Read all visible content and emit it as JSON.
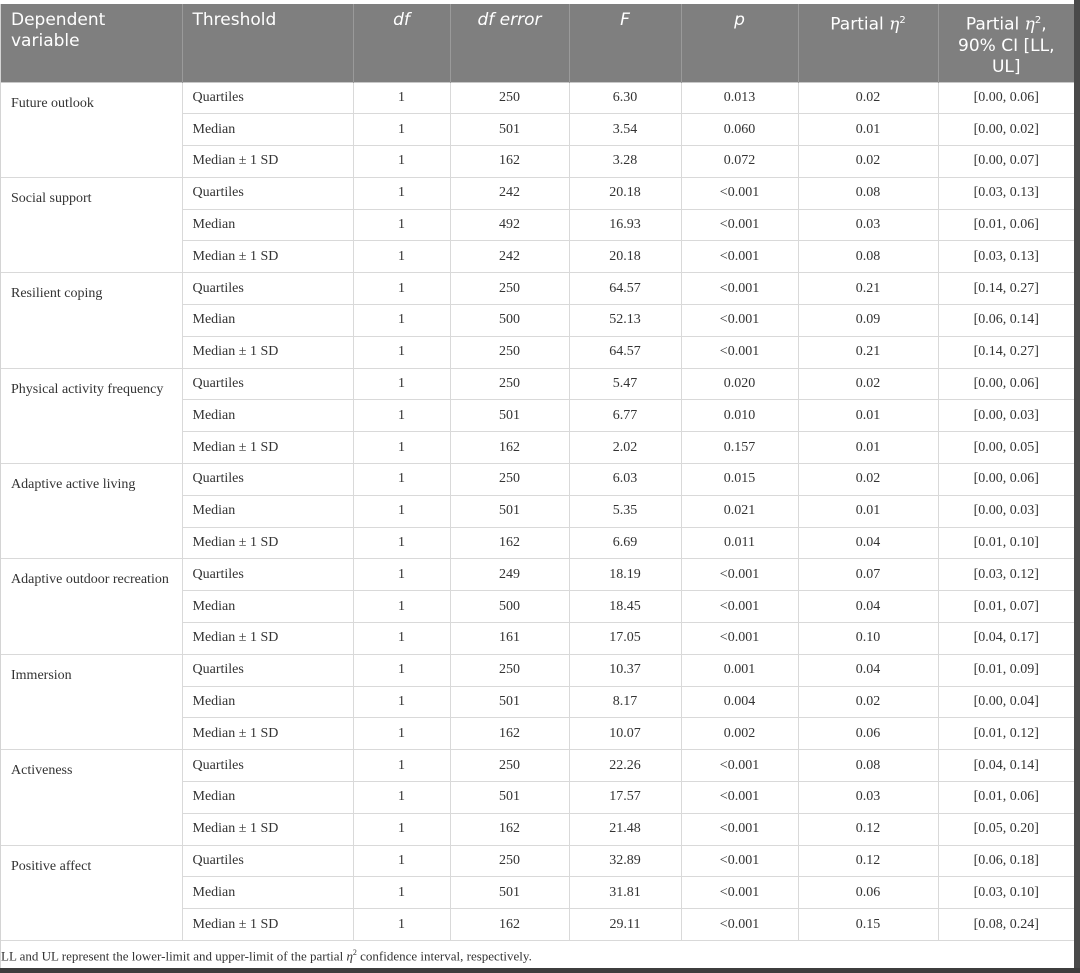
{
  "table": {
    "headers": [
      {
        "text": "Dependent variable",
        "style": "left"
      },
      {
        "text": "Threshold",
        "style": "left"
      },
      {
        "text": "df",
        "style": "center-italic"
      },
      {
        "text": "df error",
        "style": "center-italic"
      },
      {
        "text": "F",
        "style": "center-italic"
      },
      {
        "text": "p",
        "style": "center-italic"
      },
      {
        "pre": "Partial ",
        "eta": "η",
        "sup": "2",
        "post": ""
      },
      {
        "pre": "Partial ",
        "eta": "η",
        "sup": "2",
        "post": ", 90% CI [LL, UL]"
      }
    ],
    "groups": [
      {
        "variable": "Future outlook",
        "rows": [
          {
            "threshold": "Quartiles",
            "df": "1",
            "df_error": "250",
            "F": "6.30",
            "p": "0.013",
            "eta2": "0.02",
            "ci": "[0.00, 0.06]"
          },
          {
            "threshold": "Median",
            "df": "1",
            "df_error": "501",
            "F": "3.54",
            "p": "0.060",
            "eta2": "0.01",
            "ci": "[0.00, 0.02]"
          },
          {
            "threshold": "Median ± 1 SD",
            "df": "1",
            "df_error": "162",
            "F": "3.28",
            "p": "0.072",
            "eta2": "0.02",
            "ci": "[0.00, 0.07]"
          }
        ]
      },
      {
        "variable": "Social support",
        "rows": [
          {
            "threshold": "Quartiles",
            "df": "1",
            "df_error": "242",
            "F": "20.18",
            "p": "<0.001",
            "eta2": "0.08",
            "ci": "[0.03, 0.13]"
          },
          {
            "threshold": "Median",
            "df": "1",
            "df_error": "492",
            "F": "16.93",
            "p": "<0.001",
            "eta2": "0.03",
            "ci": "[0.01, 0.06]"
          },
          {
            "threshold": "Median ± 1 SD",
            "df": "1",
            "df_error": "242",
            "F": "20.18",
            "p": "<0.001",
            "eta2": "0.08",
            "ci": "[0.03, 0.13]"
          }
        ]
      },
      {
        "variable": "Resilient coping",
        "rows": [
          {
            "threshold": "Quartiles",
            "df": "1",
            "df_error": "250",
            "F": "64.57",
            "p": "<0.001",
            "eta2": "0.21",
            "ci": "[0.14, 0.27]"
          },
          {
            "threshold": "Median",
            "df": "1",
            "df_error": "500",
            "F": "52.13",
            "p": "<0.001",
            "eta2": "0.09",
            "ci": "[0.06, 0.14]"
          },
          {
            "threshold": "Median ± 1 SD",
            "df": "1",
            "df_error": "250",
            "F": "64.57",
            "p": "<0.001",
            "eta2": "0.21",
            "ci": "[0.14, 0.27]"
          }
        ]
      },
      {
        "variable": "Physical activity frequency",
        "rows": [
          {
            "threshold": "Quartiles",
            "df": "1",
            "df_error": "250",
            "F": "5.47",
            "p": "0.020",
            "eta2": "0.02",
            "ci": "[0.00, 0.06]"
          },
          {
            "threshold": "Median",
            "df": "1",
            "df_error": "501",
            "F": "6.77",
            "p": "0.010",
            "eta2": "0.01",
            "ci": "[0.00, 0.03]"
          },
          {
            "threshold": "Median ± 1 SD",
            "df": "1",
            "df_error": "162",
            "F": "2.02",
            "p": "0.157",
            "eta2": "0.01",
            "ci": "[0.00, 0.05]"
          }
        ]
      },
      {
        "variable": "Adaptive active living",
        "rows": [
          {
            "threshold": "Quartiles",
            "df": "1",
            "df_error": "250",
            "F": "6.03",
            "p": "0.015",
            "eta2": "0.02",
            "ci": "[0.00, 0.06]"
          },
          {
            "threshold": "Median",
            "df": "1",
            "df_error": "501",
            "F": "5.35",
            "p": "0.021",
            "eta2": "0.01",
            "ci": "[0.00, 0.03]"
          },
          {
            "threshold": "Median ± 1 SD",
            "df": "1",
            "df_error": "162",
            "F": "6.69",
            "p": "0.011",
            "eta2": "0.04",
            "ci": "[0.01, 0.10]"
          }
        ]
      },
      {
        "variable": "Adaptive outdoor recreation",
        "rows": [
          {
            "threshold": "Quartiles",
            "df": "1",
            "df_error": "249",
            "F": "18.19",
            "p": "<0.001",
            "eta2": "0.07",
            "ci": "[0.03, 0.12]"
          },
          {
            "threshold": "Median",
            "df": "1",
            "df_error": "500",
            "F": "18.45",
            "p": "<0.001",
            "eta2": "0.04",
            "ci": "[0.01, 0.07]"
          },
          {
            "threshold": "Median ± 1 SD",
            "df": "1",
            "df_error": "161",
            "F": "17.05",
            "p": "<0.001",
            "eta2": "0.10",
            "ci": "[0.04, 0.17]"
          }
        ]
      },
      {
        "variable": "Immersion",
        "rows": [
          {
            "threshold": "Quartiles",
            "df": "1",
            "df_error": "250",
            "F": "10.37",
            "p": "0.001",
            "eta2": "0.04",
            "ci": "[0.01, 0.09]"
          },
          {
            "threshold": "Median",
            "df": "1",
            "df_error": "501",
            "F": "8.17",
            "p": "0.004",
            "eta2": "0.02",
            "ci": "[0.00, 0.04]"
          },
          {
            "threshold": "Median ± 1 SD",
            "df": "1",
            "df_error": "162",
            "F": "10.07",
            "p": "0.002",
            "eta2": "0.06",
            "ci": "[0.01, 0.12]"
          }
        ]
      },
      {
        "variable": "Activeness",
        "rows": [
          {
            "threshold": "Quartiles",
            "df": "1",
            "df_error": "250",
            "F": "22.26",
            "p": "<0.001",
            "eta2": "0.08",
            "ci": "[0.04, 0.14]"
          },
          {
            "threshold": "Median",
            "df": "1",
            "df_error": "501",
            "F": "17.57",
            "p": "<0.001",
            "eta2": "0.03",
            "ci": "[0.01, 0.06]"
          },
          {
            "threshold": "Median ± 1 SD",
            "df": "1",
            "df_error": "162",
            "F": "21.48",
            "p": "<0.001",
            "eta2": "0.12",
            "ci": "[0.05, 0.20]"
          }
        ]
      },
      {
        "variable": "Positive affect",
        "rows": [
          {
            "threshold": "Quartiles",
            "df": "1",
            "df_error": "250",
            "F": "32.89",
            "p": "<0.001",
            "eta2": "0.12",
            "ci": "[0.06, 0.18]"
          },
          {
            "threshold": "Median",
            "df": "1",
            "df_error": "501",
            "F": "31.81",
            "p": "<0.001",
            "eta2": "0.06",
            "ci": "[0.03, 0.10]"
          },
          {
            "threshold": "Median ± 1 SD",
            "df": "1",
            "df_error": "162",
            "F": "29.11",
            "p": "<0.001",
            "eta2": "0.15",
            "ci": "[0.08, 0.24]"
          }
        ]
      }
    ]
  },
  "footnote": {
    "pre": "LL and UL represent the lower-limit and upper-limit of the partial ",
    "eta": "η",
    "sup": "2",
    "post": " confidence interval, respectively."
  },
  "colors": {
    "header_bg": "#7f7f7f",
    "header_text": "#ffffff",
    "grid": "#d9d9d9",
    "body_text": "#333333"
  }
}
